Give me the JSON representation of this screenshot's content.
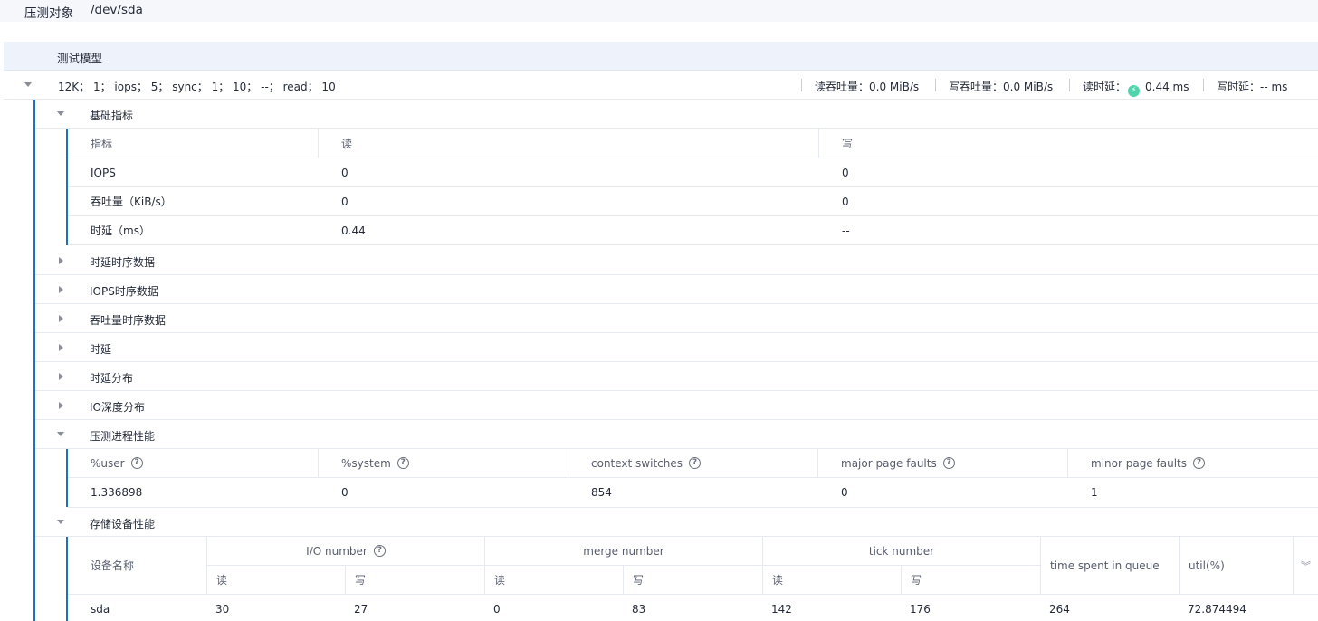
{
  "target": {
    "label": "压测对象",
    "value": "/dev/sda"
  },
  "model": {
    "title": "测试模型",
    "params": "12K；  1；  iops；  5；  sync；  1；  10；  --；  read；  10",
    "metrics": {
      "read_throughput": "读吞吐量：0.0 MiB/s",
      "write_throughput": "写吞吐量：0.0 MiB/s",
      "read_latency_label": "读时延：",
      "read_latency_value": "0.44 ms",
      "write_latency": "写时延：-- ms"
    }
  },
  "basic": {
    "title": "基础指标",
    "headers": [
      "指标",
      "读",
      "写"
    ],
    "rows": [
      [
        "IOPS",
        "0",
        "0"
      ],
      [
        "吞吐量（KiB/s）",
        "0",
        "0"
      ],
      [
        "时延（ms）",
        "0.44",
        "--"
      ]
    ]
  },
  "collapsed_sections": [
    "时延时序数据",
    "IOPS时序数据",
    "吞吐量时序数据",
    "时延",
    "时延分布",
    "IO深度分布"
  ],
  "process": {
    "title": "压测进程性能",
    "headers": [
      "%user",
      "%system",
      "context switches",
      "major page faults",
      "minor page faults"
    ],
    "values": [
      "1.336898",
      "0",
      "854",
      "0",
      "1"
    ]
  },
  "storage": {
    "title": "存储设备性能",
    "device_header": "设备名称",
    "groups": [
      "I/O number",
      "merge number",
      "tick number"
    ],
    "sub_read": "读",
    "sub_write": "写",
    "queue_header": "time spent in queue",
    "util_header": "util(%)",
    "row": [
      "sda",
      "30",
      "27",
      "0",
      "83",
      "142",
      "176",
      "264",
      "72.874494"
    ]
  }
}
